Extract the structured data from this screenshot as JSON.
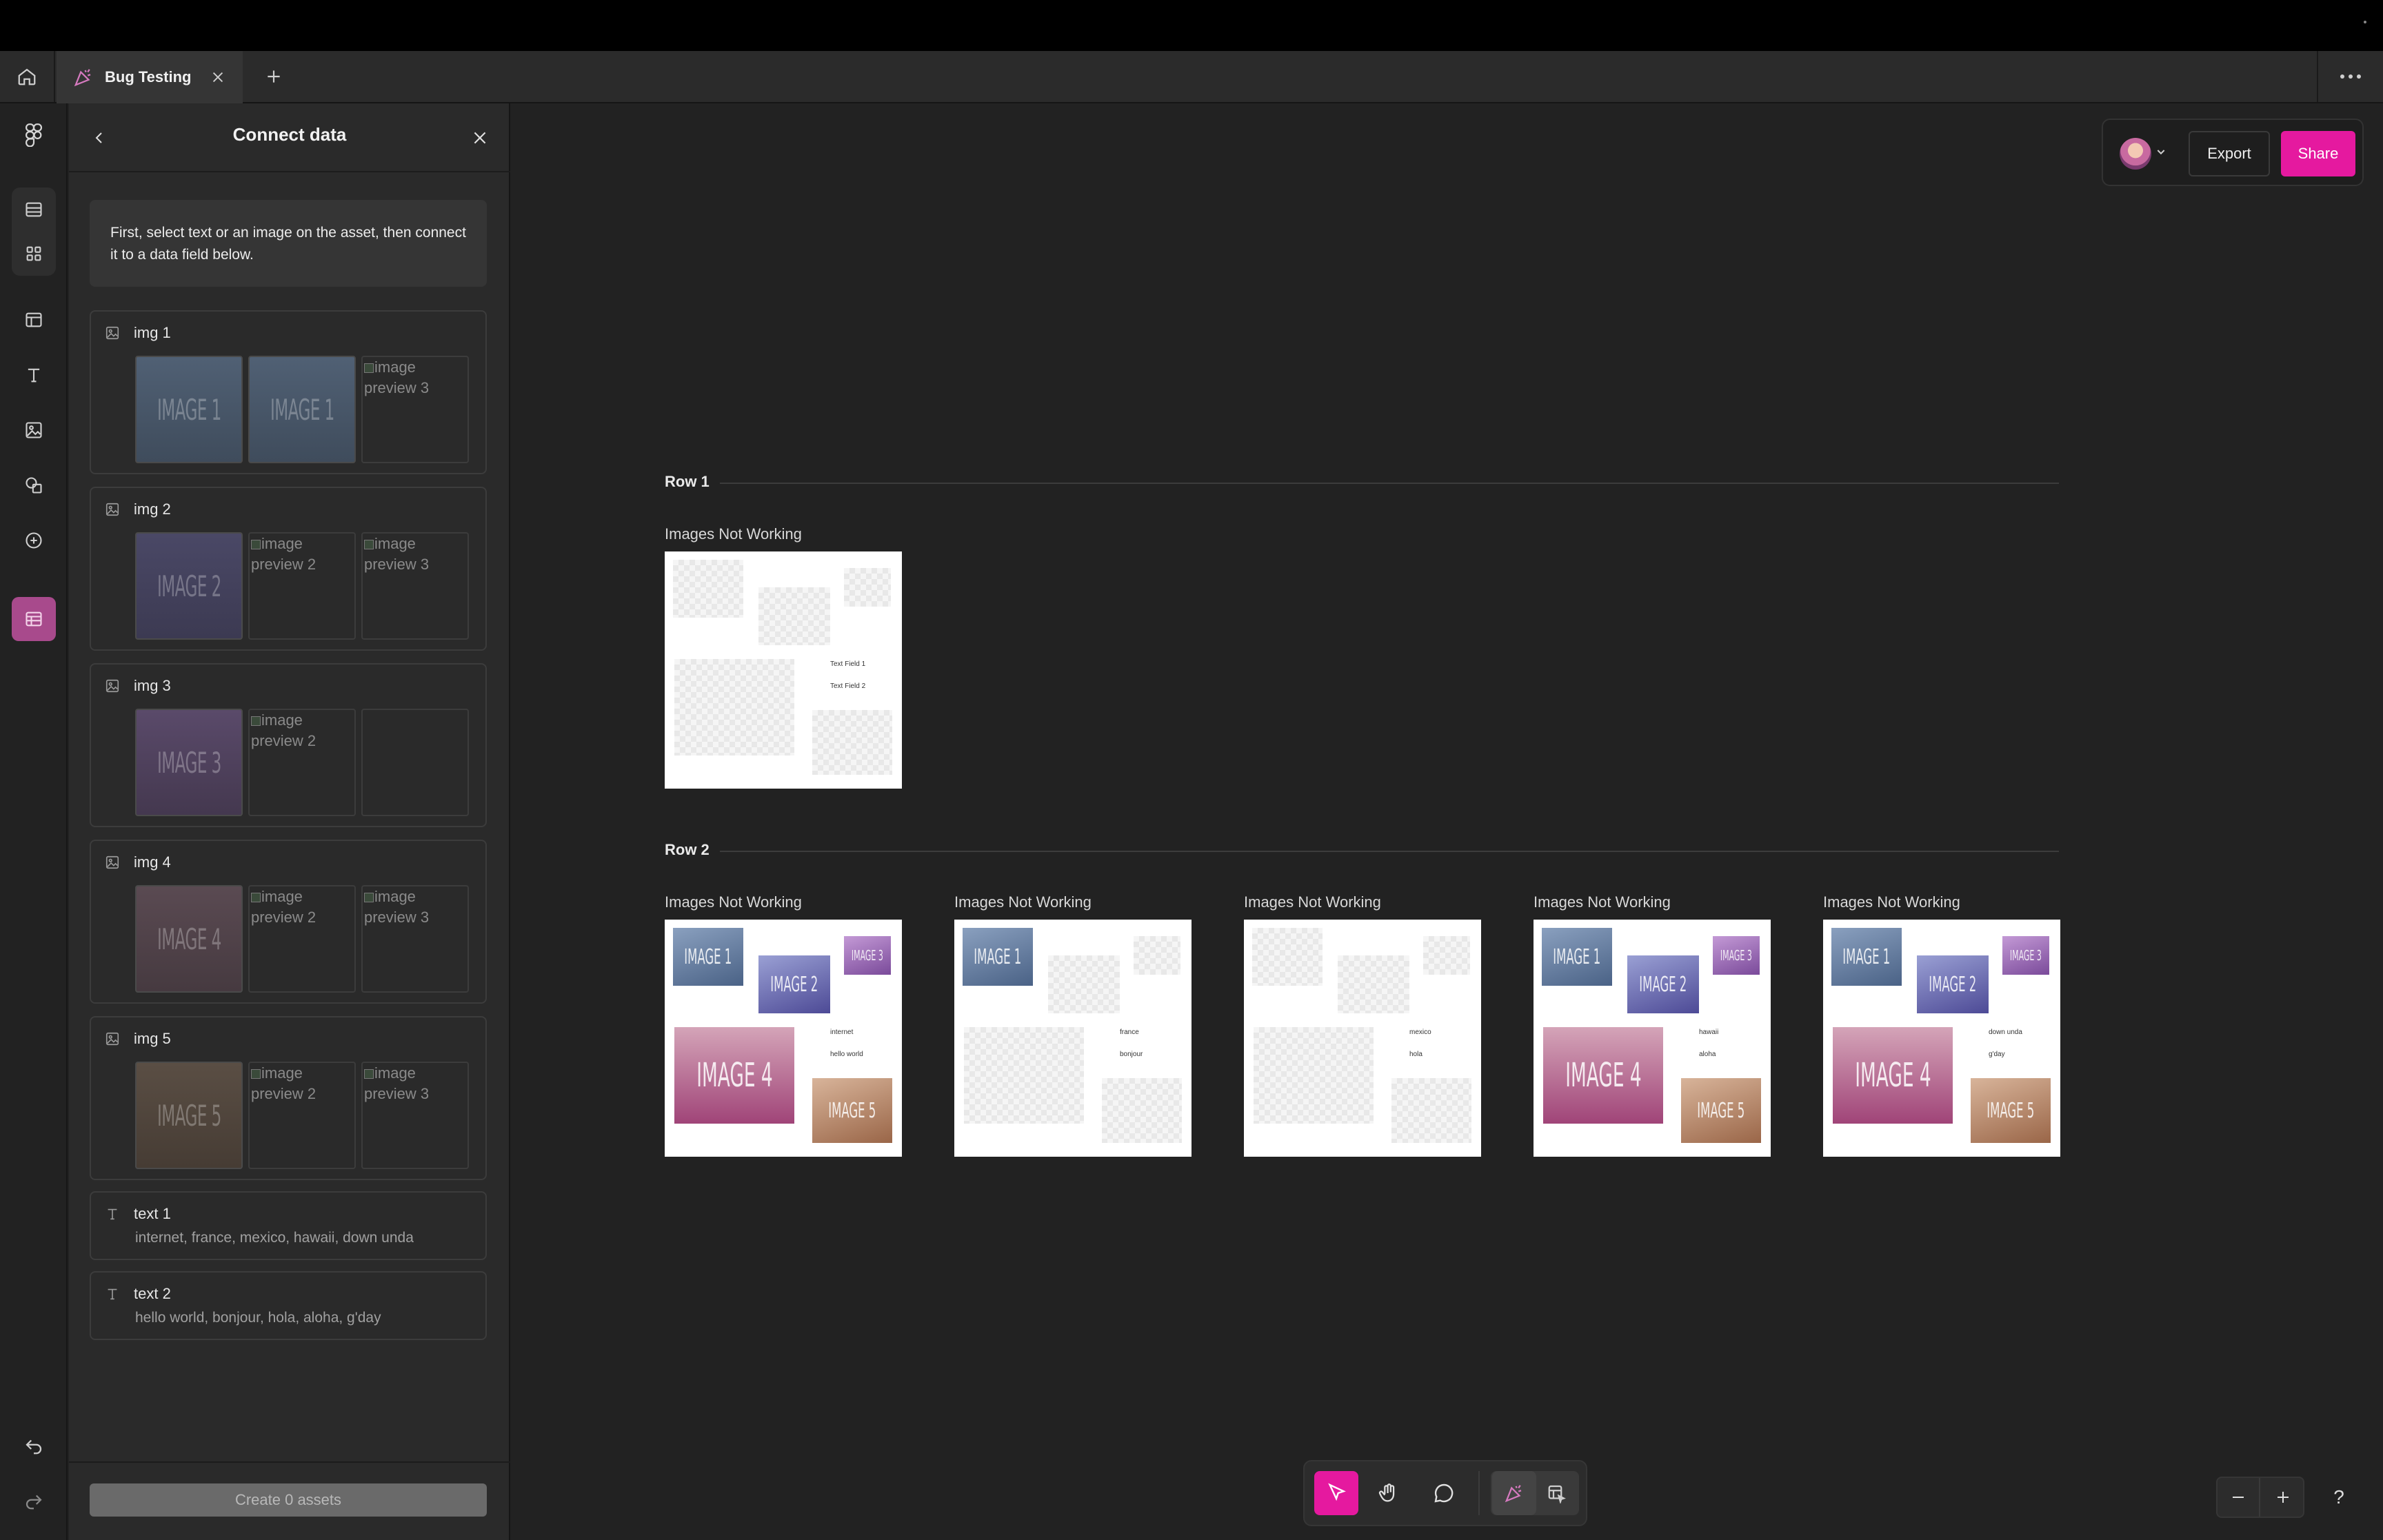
{
  "tab": {
    "title": "Bug Testing"
  },
  "panel": {
    "title": "Connect data",
    "info": "First, select text or an image on the asset, then connect it to a data field below.",
    "image_fields": [
      {
        "label": "img 1",
        "thumbs": [
          {
            "kind": "image",
            "text": "IMAGE 1",
            "tone": "pg1"
          },
          {
            "kind": "image",
            "text": "IMAGE 1",
            "tone": "pg1"
          },
          {
            "kind": "broken",
            "text": "image preview 3"
          }
        ]
      },
      {
        "label": "img 2",
        "thumbs": [
          {
            "kind": "image",
            "text": "IMAGE 2",
            "tone": "pg2"
          },
          {
            "kind": "broken",
            "text": "image preview 2"
          },
          {
            "kind": "broken",
            "text": "image preview 3"
          }
        ]
      },
      {
        "label": "img 3",
        "thumbs": [
          {
            "kind": "image",
            "text": "IMAGE 3",
            "tone": "pg3"
          },
          {
            "kind": "broken",
            "text": "image preview 2"
          },
          {
            "kind": "empty",
            "text": ""
          }
        ]
      },
      {
        "label": "img 4",
        "thumbs": [
          {
            "kind": "image",
            "text": "IMAGE 4",
            "tone": "pg4"
          },
          {
            "kind": "broken",
            "text": "image preview 2"
          },
          {
            "kind": "broken",
            "text": "image preview 3"
          }
        ]
      },
      {
        "label": "img 5",
        "thumbs": [
          {
            "kind": "image",
            "text": "IMAGE 5",
            "tone": "pg5"
          },
          {
            "kind": "broken",
            "text": "image preview 2"
          },
          {
            "kind": "broken",
            "text": "image preview 3"
          }
        ]
      }
    ],
    "text_fields": [
      {
        "label": "text 1",
        "values": "internet, france, mexico, hawaii, down unda"
      },
      {
        "label": "text 2",
        "values": "hello world, bonjour, hola, aloha, g'day"
      }
    ],
    "create_label": "Create 0 assets"
  },
  "toolbar": {
    "export_label": "Export",
    "share_label": "Share",
    "accent_color": "#e5199f"
  },
  "canvas": {
    "rows": [
      {
        "label": "Row 1",
        "assets": [
          {
            "title": "Images Not Working",
            "text1": "Text Field 1",
            "text2": "Text Field 2",
            "filled": false
          }
        ]
      },
      {
        "label": "Row 2",
        "assets": [
          {
            "title": "Images Not Working",
            "text1": "internet",
            "text2": "hello world",
            "filled": true
          },
          {
            "title": "Images Not Working",
            "text1": "france",
            "text2": "bonjour",
            "filled": false,
            "first_only": true
          },
          {
            "title": "Images Not Working",
            "text1": "mexico",
            "text2": "hola",
            "filled": false
          },
          {
            "title": "Images Not Working",
            "text1": "hawaii",
            "text2": "aloha",
            "filled": true
          },
          {
            "title": "Images Not Working",
            "text1": "down unda",
            "text2": "g'day",
            "filled": true
          }
        ]
      }
    ],
    "slot_images": [
      "IMAGE 1",
      "IMAGE 2",
      "IMAGE 3",
      "IMAGE 4",
      "IMAGE 5"
    ]
  },
  "help_label": "?"
}
